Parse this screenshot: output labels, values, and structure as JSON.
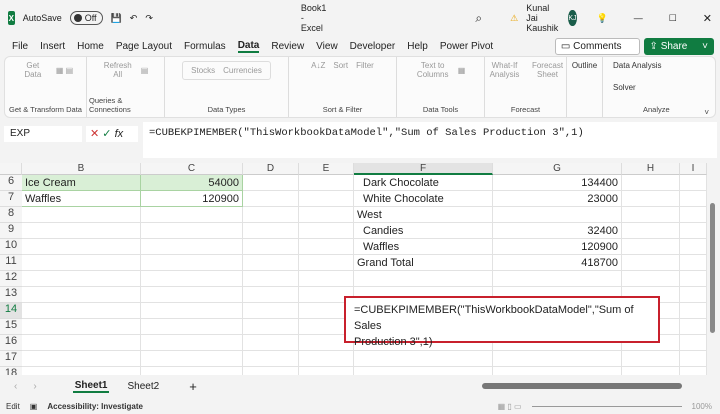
{
  "titlebar": {
    "autosave": "AutoSave",
    "toggle": "Off",
    "doc": "Book1 - Excel",
    "user": "Kunal Jai Kaushik",
    "initials": "KJ"
  },
  "menu": [
    "File",
    "Insert",
    "Home",
    "Page Layout",
    "Formulas",
    "Data",
    "Review",
    "View",
    "Developer",
    "Help",
    "Power Pivot"
  ],
  "buttons": {
    "comments": "Comments",
    "share": "Share"
  },
  "ribbon": {
    "get": "Get Data",
    "g1": "Get & Transform Data",
    "refresh": "Refresh All",
    "g2": "Queries & Connections",
    "stocks": "Stocks",
    "currencies": "Currencies",
    "g3": "Data Types",
    "sort": "Sort",
    "filter": "Filter",
    "g4": "Sort & Filter",
    "ttc": "Text to Columns",
    "g5": "Data Tools",
    "whatif": "What-If Analysis",
    "forecast": "Forecast Sheet",
    "g6": "Forecast",
    "outline": "Outline",
    "analysis": "Data Analysis",
    "solver": "Solver",
    "g7": "Analyze"
  },
  "namebox": "EXP",
  "formula": "=CUBEKPIMEMBER(\"ThisWorkbookDataModel\",\"Sum of Sales Production 3\",1)",
  "columns": [
    "B",
    "C",
    "D",
    "E",
    "F",
    "G",
    "H",
    "I"
  ],
  "rows": [
    "6",
    "7",
    "8",
    "9",
    "10",
    "11",
    "12",
    "13",
    "14",
    "15",
    "16",
    "17",
    "18"
  ],
  "cells": {
    "b6": "Ice Cream",
    "c6": "54000",
    "b7": "Waffles",
    "c7": "120900",
    "f6": "Dark Chocolate",
    "g6": "134400",
    "f7": "White Chocolate",
    "g7": "23000",
    "f8": "West",
    "f9": "Candies",
    "g9": "32400",
    "f10": "Waffles",
    "g10": "120900",
    "f11": "Grand Total",
    "g11": "418700"
  },
  "edit_line1": "=CUBEKPIMEMBER(\"ThisWorkbookDataModel\",\"Sum of Sales",
  "edit_line2": "Production 3\",1)",
  "sheets": [
    "Sheet1",
    "Sheet2"
  ],
  "status": {
    "mode": "Edit",
    "accessibility": "Accessibility: Investigate",
    "zoom": "100%"
  }
}
